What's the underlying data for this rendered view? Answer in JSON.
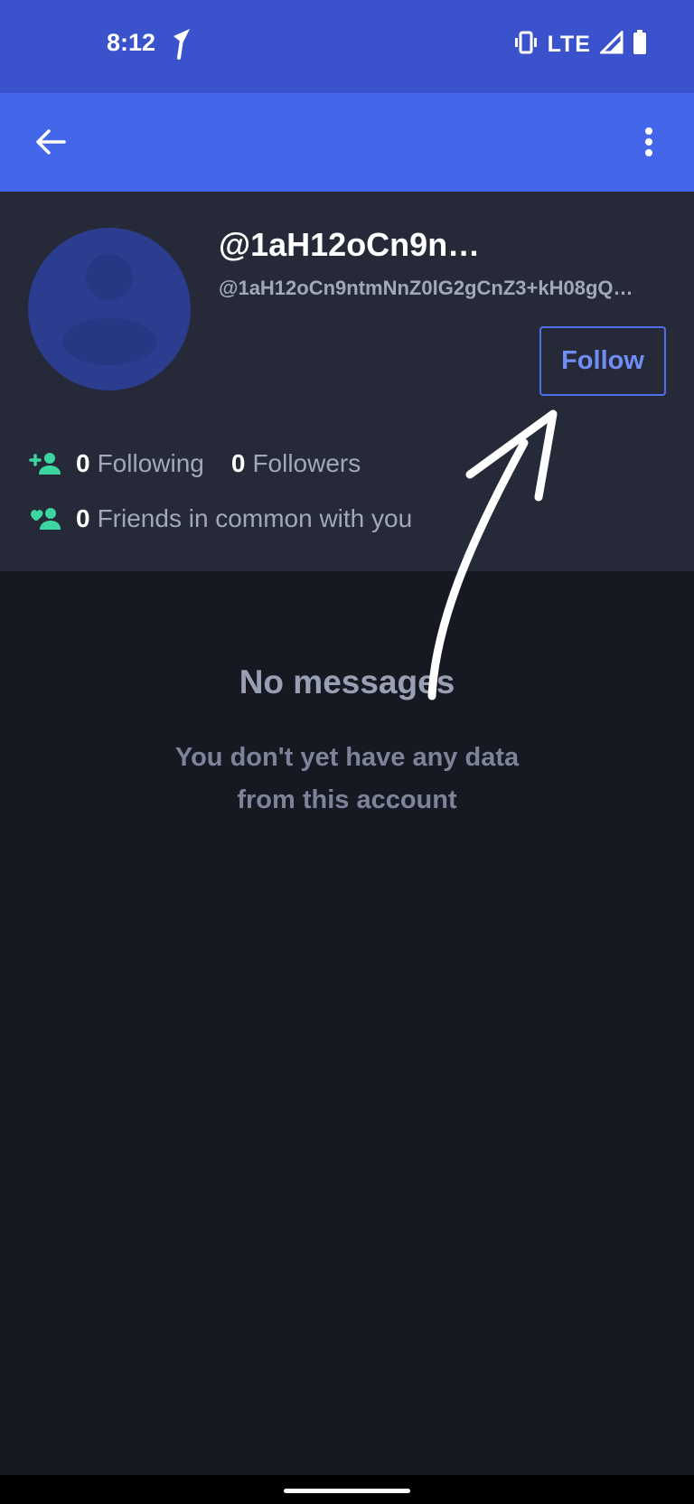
{
  "status_bar": {
    "time": "8:12",
    "network": "LTE",
    "icons": [
      "navigation-icon",
      "vibrate-icon",
      "signal-icon",
      "battery-icon"
    ]
  },
  "app_bar": {
    "back_icon": "arrow-left-icon",
    "menu_icon": "more-vertical-icon"
  },
  "profile": {
    "display_name": "@1aH12oCn9n…",
    "handle": "@1aH12oCn9ntmNnZ0lG2gCnZ3+kH08gQ…",
    "follow_label": "Follow",
    "following_count": "0",
    "following_label": "Following",
    "followers_count": "0",
    "followers_label": "Followers",
    "friends_count": "0",
    "friends_label": "Friends in common with you"
  },
  "empty_state": {
    "title": "No messages",
    "line1": "You don't yet have any data",
    "line2": "from this account"
  },
  "colors": {
    "status_bar": "#3A53CC",
    "app_bar": "#4366EB",
    "card": "#262A38",
    "background": "#161922",
    "accent_green": "#3DD6A0",
    "follow_blue": "#6F8DF5"
  }
}
